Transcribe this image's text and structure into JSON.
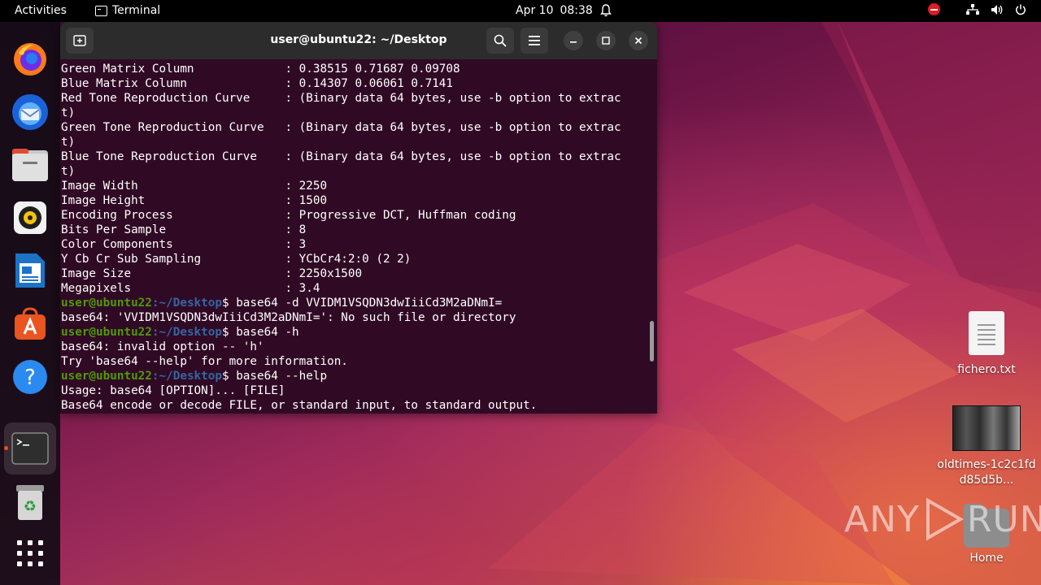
{
  "topbar": {
    "activities": "Activities",
    "app_name": "Terminal",
    "date": "Apr 10",
    "time": "08:38"
  },
  "dock": {
    "items": [
      {
        "name": "firefox-icon"
      },
      {
        "name": "thunderbird-icon"
      },
      {
        "name": "files-icon"
      },
      {
        "name": "rhythmbox-icon"
      },
      {
        "name": "writer-icon"
      },
      {
        "name": "software-icon"
      },
      {
        "name": "help-icon"
      },
      {
        "name": "terminal-icon"
      },
      {
        "name": "trash-icon"
      },
      {
        "name": "show-apps-icon"
      }
    ]
  },
  "terminal": {
    "title": "user@ubuntu22: ~/Desktop",
    "prompt_user": "user@ubuntu22",
    "prompt_path": ":~/Desktop",
    "lines": [
      {
        "type": "out",
        "text": "Green Matrix Column             : 0.38515 0.71687 0.09708"
      },
      {
        "type": "out",
        "text": "Blue Matrix Column              : 0.14307 0.06061 0.7141"
      },
      {
        "type": "out",
        "text": "Red Tone Reproduction Curve     : (Binary data 64 bytes, use -b option to extrac"
      },
      {
        "type": "out",
        "text": "t)"
      },
      {
        "type": "out",
        "text": "Green Tone Reproduction Curve   : (Binary data 64 bytes, use -b option to extrac"
      },
      {
        "type": "out",
        "text": "t)"
      },
      {
        "type": "out",
        "text": "Blue Tone Reproduction Curve    : (Binary data 64 bytes, use -b option to extrac"
      },
      {
        "type": "out",
        "text": "t)"
      },
      {
        "type": "out",
        "text": "Image Width                     : 2250"
      },
      {
        "type": "out",
        "text": "Image Height                    : 1500"
      },
      {
        "type": "out",
        "text": "Encoding Process                : Progressive DCT, Huffman coding"
      },
      {
        "type": "out",
        "text": "Bits Per Sample                 : 8"
      },
      {
        "type": "out",
        "text": "Color Components                : 3"
      },
      {
        "type": "out",
        "text": "Y Cb Cr Sub Sampling            : YCbCr4:2:0 (2 2)"
      },
      {
        "type": "out",
        "text": "Image Size                      : 2250x1500"
      },
      {
        "type": "out",
        "text": "Megapixels                      : 3.4"
      },
      {
        "type": "cmd",
        "text": "$ base64 -d VVIDM1VSQDN3dwIiiCd3M2aDNmI="
      },
      {
        "type": "out",
        "text": "base64: 'VVIDM1VSQDN3dwIiiCd3M2aDNmI=': No such file or directory"
      },
      {
        "type": "cmd",
        "text": "$ base64 -h"
      },
      {
        "type": "out",
        "text": "base64: invalid option -- 'h'"
      },
      {
        "type": "out",
        "text": "Try 'base64 --help' for more information."
      },
      {
        "type": "cmd",
        "text": "$ base64 --help"
      },
      {
        "type": "out",
        "text": "Usage: base64 [OPTION]... [FILE]"
      },
      {
        "type": "out",
        "text": "Base64 encode or decode FILE, or standard input, to standard output."
      }
    ]
  },
  "desktop": {
    "icons": [
      {
        "label": "fichero.txt"
      },
      {
        "label": "oldtimes-1c2c1fdd85d5b..."
      },
      {
        "label": "Home"
      }
    ]
  },
  "watermark": {
    "left": "ANY",
    "right": "RUN"
  }
}
